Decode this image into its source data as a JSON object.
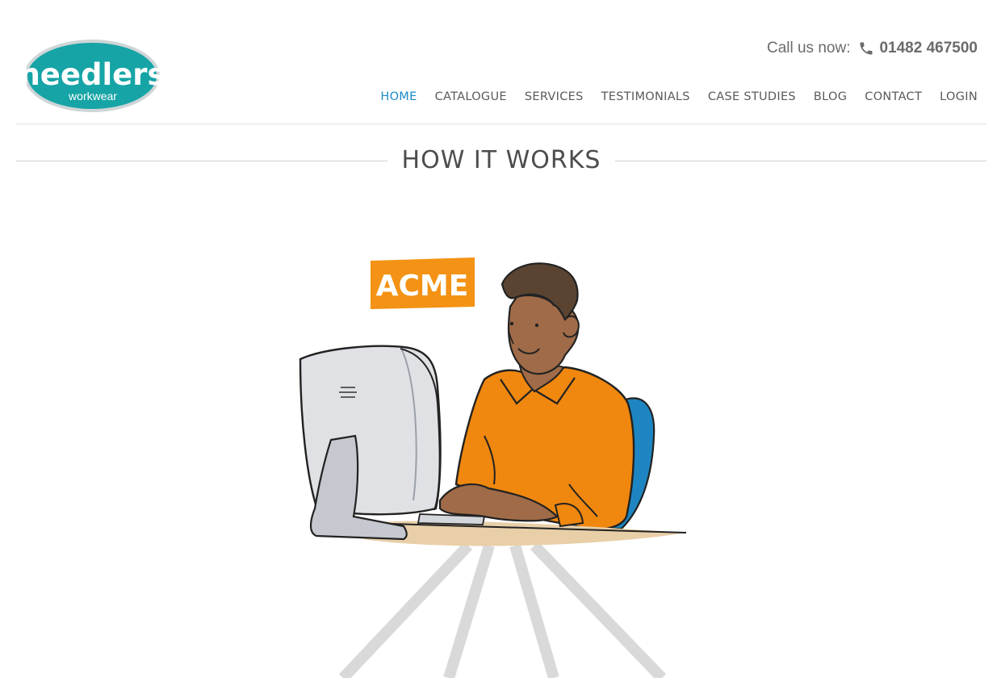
{
  "header": {
    "logo": {
      "brand": "needlers",
      "tagline": "workwear"
    },
    "call_label": "Call us now:",
    "phone_number": "01482 467500",
    "phone_icon": "phone-icon"
  },
  "nav": {
    "items": [
      {
        "label": "HOME",
        "active": true
      },
      {
        "label": "CATALOGUE",
        "active": false
      },
      {
        "label": "SERVICES",
        "active": false
      },
      {
        "label": "TESTIMONIALS",
        "active": false
      },
      {
        "label": "CASE STUDIES",
        "active": false
      },
      {
        "label": "BLOG",
        "active": false
      },
      {
        "label": "CONTACT",
        "active": false
      },
      {
        "label": "LOGIN",
        "active": false
      }
    ]
  },
  "section": {
    "title": "HOW IT WORKS"
  },
  "illustration": {
    "sign_text": "ACME"
  },
  "colors": {
    "brand_teal": "#16a4a6",
    "nav_active": "#1a8ac9",
    "acme_orange": "#f39214",
    "shirt_orange": "#f0870e",
    "chair_blue": "#1d86c2"
  }
}
